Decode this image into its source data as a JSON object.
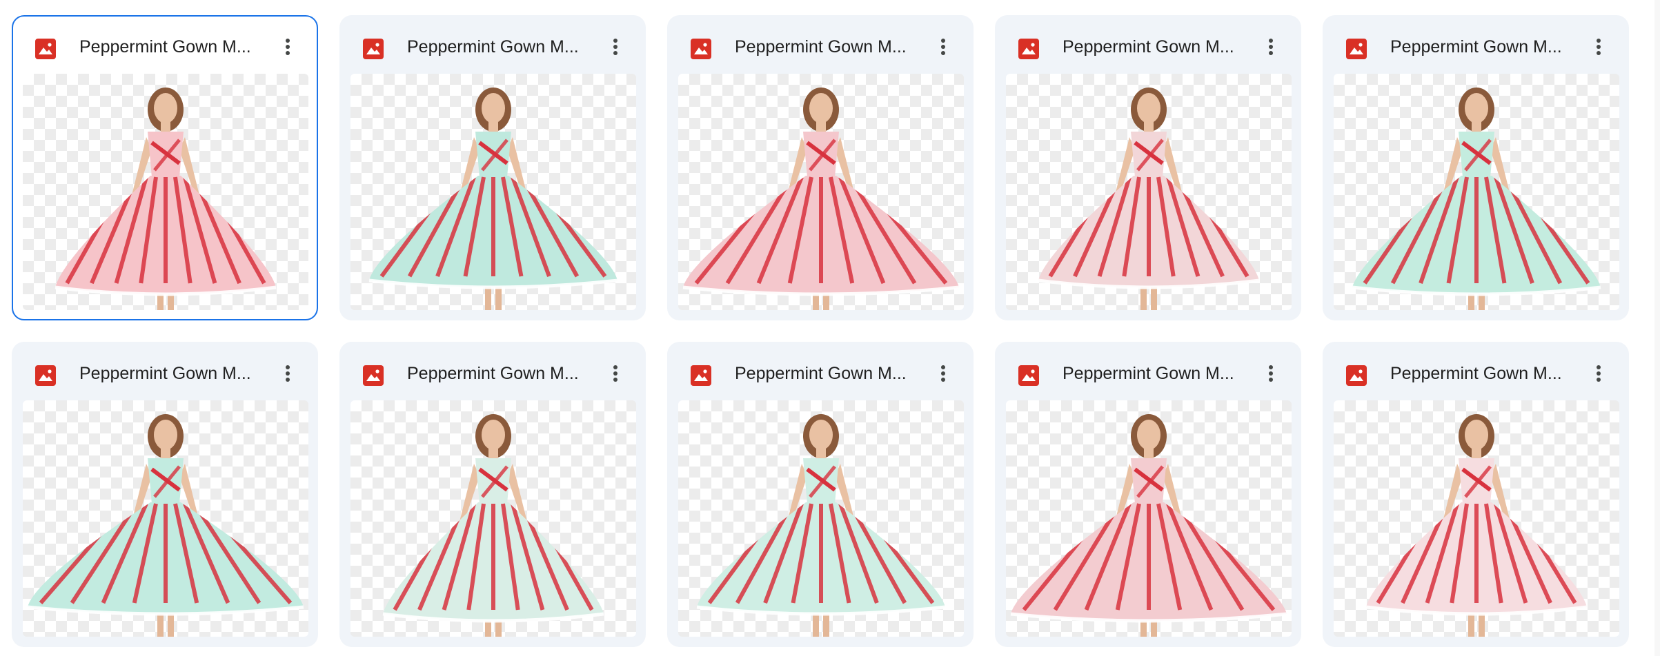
{
  "files": [
    {
      "name": "Peppermint Gown M...",
      "icon": "image-file-icon",
      "selected": true,
      "dress": "#f6c4c9"
    },
    {
      "name": "Peppermint Gown M...",
      "icon": "image-file-icon",
      "selected": false,
      "dress": "#bfe9de"
    },
    {
      "name": "Peppermint Gown M...",
      "icon": "image-file-icon",
      "selected": false,
      "dress": "#f4c7cc"
    },
    {
      "name": "Peppermint Gown M...",
      "icon": "image-file-icon",
      "selected": false,
      "dress": "#f2d6d8"
    },
    {
      "name": "Peppermint Gown M...",
      "icon": "image-file-icon",
      "selected": false,
      "dress": "#c4ecdf"
    },
    {
      "name": "Peppermint Gown M...",
      "icon": "image-file-icon",
      "selected": false,
      "dress": "#c2ebe0"
    },
    {
      "name": "Peppermint Gown M...",
      "icon": "image-file-icon",
      "selected": false,
      "dress": "#d9eee6"
    },
    {
      "name": "Peppermint Gown M...",
      "icon": "image-file-icon",
      "selected": false,
      "dress": "#cfeee4"
    },
    {
      "name": "Peppermint Gown M...",
      "icon": "image-file-icon",
      "selected": false,
      "dress": "#f3ccd0"
    },
    {
      "name": "Peppermint Gown M...",
      "icon": "image-file-icon",
      "selected": false,
      "dress": "#f6dde0"
    }
  ],
  "colors": {
    "icon_red": "#d93025",
    "selection_blue": "#1a73e8",
    "card_bg": "#f0f4f9",
    "stripe_red": "#d8323e"
  },
  "icons": {
    "file_type": "image-file-icon",
    "more": "more-vert-icon"
  }
}
